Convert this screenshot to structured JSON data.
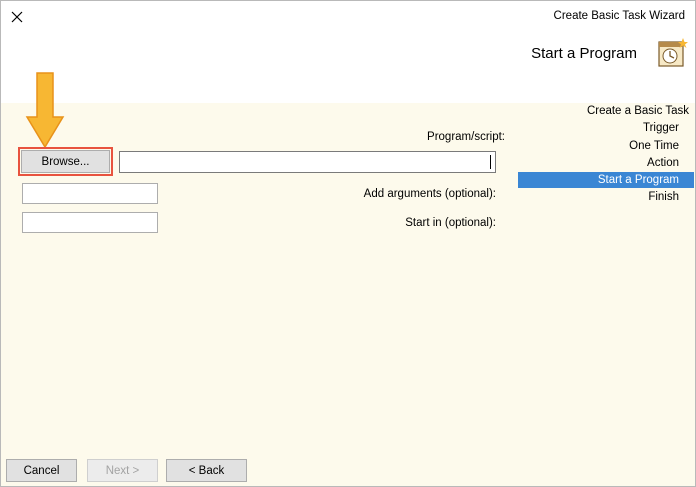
{
  "window": {
    "title": "Create Basic Task Wizard"
  },
  "header": {
    "heading": "Start a Program"
  },
  "nav": {
    "items": [
      {
        "label": "Create a Basic Task"
      },
      {
        "label": "Trigger"
      },
      {
        "label": "One Time"
      },
      {
        "label": "Action"
      },
      {
        "label": "Start a Program"
      },
      {
        "label": "Finish"
      }
    ],
    "selected": "Start a Program"
  },
  "form": {
    "program_label": "Program/script:",
    "program_value": "",
    "browse_label": "Browse...",
    "arguments_label": "Add arguments (optional):",
    "arguments_value": "",
    "startin_label": "Start in (optional):",
    "startin_value": ""
  },
  "footer": {
    "back_label": "< Back",
    "next_label": "Next >",
    "cancel_label": "Cancel"
  },
  "colors": {
    "accent": "#3a86d4",
    "highlight": "#e8533f",
    "arrow": "#f5a623",
    "background": "#fdfaec"
  }
}
